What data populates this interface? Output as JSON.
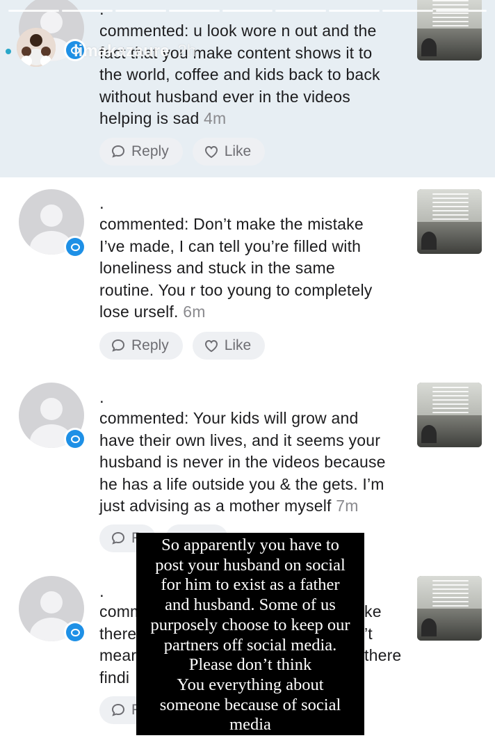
{
  "story": {
    "username": "limakazaure",
    "time": "2h",
    "progress_segments": 9
  },
  "comments": [
    {
      "name": ".",
      "text_lines": [
        "commented: u look wore n out and the",
        "fact that you make content shows it to",
        "the world, coffee and kids back to back",
        "without husband ever in the videos"
      ],
      "last_line": "helping is sad",
      "time": "4m",
      "reply_label": "Reply",
      "like_label": "Like"
    },
    {
      "name": ".",
      "text_lines": [
        "commented: Don’t make the mistake",
        "I’ve made, I can tell you’re filled with",
        "loneliness and stuck in the same",
        "routine. You r too young to completely"
      ],
      "last_line": "lose urself.",
      "time": "6m",
      "reply_label": "Reply",
      "like_label": "Like"
    },
    {
      "name": ".",
      "text_lines": [
        "commented: Your kids will grow and",
        "have their own lives, and it seems your",
        "husband is never in the videos because",
        "he has a life outside you & the gets. I’m"
      ],
      "last_line": "just advising as a mother myself",
      "time": "7m",
      "reply_label": "R",
      "like_label": ""
    },
    {
      "name": ".",
      "text_lines": [
        "comm",
        "there",
        "mear",
        "findi"
      ],
      "right_fragments": [
        "ke",
        "’t",
        "there",
        ""
      ],
      "last_line": "",
      "time": "",
      "reply_label": "R",
      "like_label": ""
    }
  ],
  "overlay_caption": {
    "lines": [
      "So apparently you have to",
      "post your husband on social",
      "for him to exist as a father",
      "and husband. Some of us",
      "purposely choose to keep our",
      "partners off social media.",
      "Please don’t think",
      "You everything about",
      "someone because of social",
      "media"
    ]
  },
  "colors": {
    "first_comment_bg": "#e7eef3",
    "badge_blue": "#1e90e6",
    "story_dot": "#2aa7c9",
    "overlay_bg": "#000000",
    "timestamp_gray": "#8a8a8e"
  }
}
